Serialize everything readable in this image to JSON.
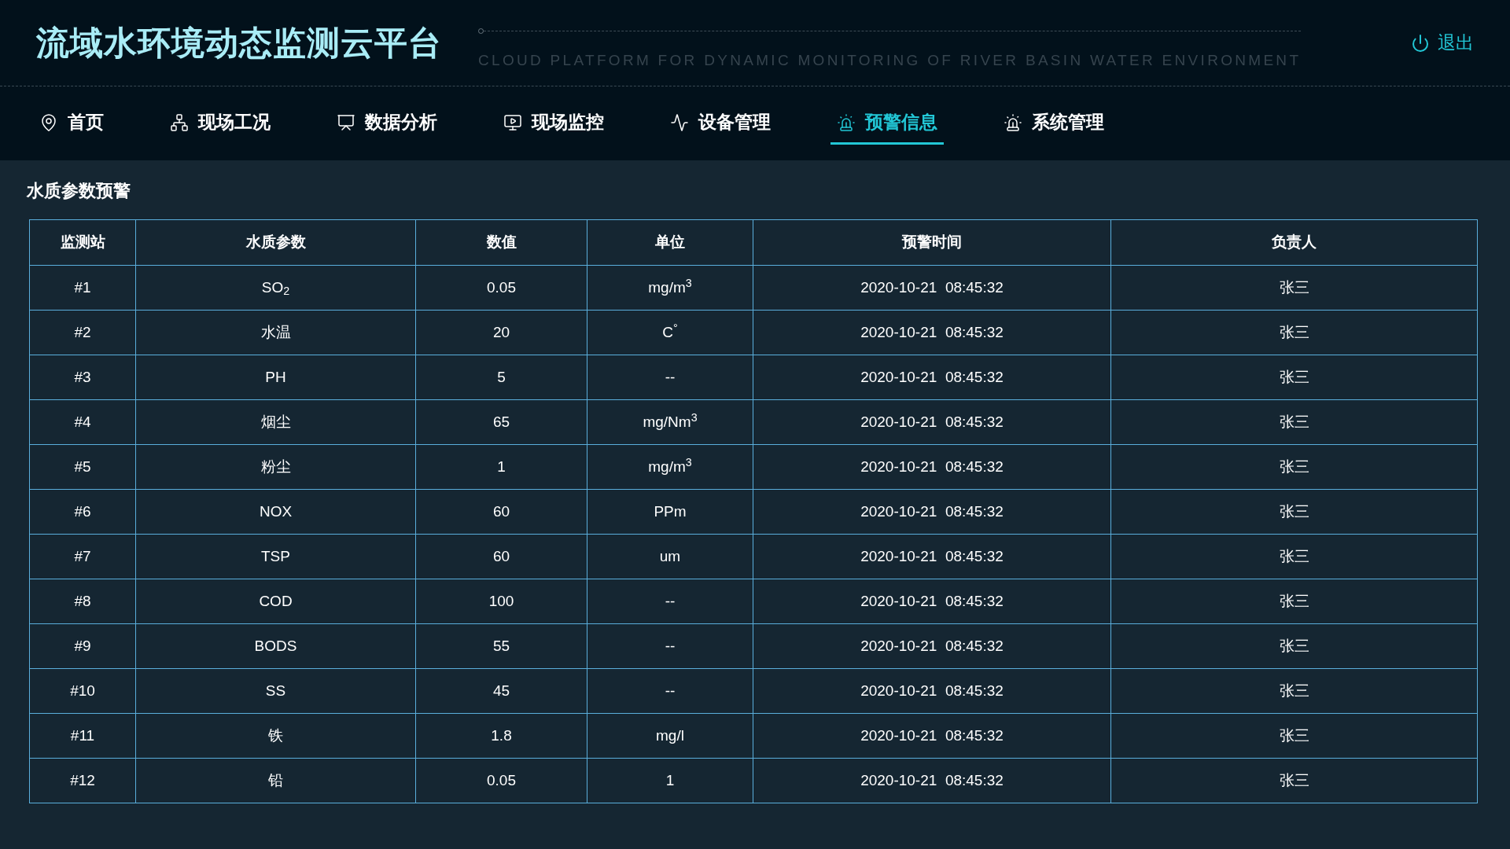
{
  "header": {
    "title": "流域水环境动态监测云平台",
    "subtitle": "CLOUD PLATFORM FOR DYNAMIC MONITORING OF RIVER BASIN WATER ENVIRONMENT",
    "logout": "退出"
  },
  "nav": [
    {
      "label": "首页",
      "selected": false
    },
    {
      "label": "现场工况",
      "selected": false
    },
    {
      "label": "数据分析",
      "selected": false
    },
    {
      "label": "现场监控",
      "selected": false
    },
    {
      "label": "设备管理",
      "selected": false
    },
    {
      "label": "预警信息",
      "selected": true
    },
    {
      "label": "系统管理",
      "selected": false
    }
  ],
  "section_title": "水质参数预警",
  "table": {
    "columns": [
      "监测站",
      "水质参数",
      "数值",
      "单位",
      "预警时间",
      "负责人"
    ],
    "rows": [
      [
        "#1",
        "SO$_{2}$",
        "0.05",
        "mg/m$^{3}$",
        "2020-10-21  08:45:32",
        "张三"
      ],
      [
        "#2",
        "水温",
        "20",
        "C$^{°}$",
        "2020-10-21  08:45:32",
        "张三"
      ],
      [
        "#3",
        "PH",
        "5",
        "--",
        "2020-10-21  08:45:32",
        "张三"
      ],
      [
        "#4",
        "烟尘",
        "65",
        "mg/Nm$^{3}$",
        "2020-10-21  08:45:32",
        "张三"
      ],
      [
        "#5",
        "粉尘",
        "1",
        "mg/m$^{3}$",
        "2020-10-21  08:45:32",
        "张三"
      ],
      [
        "#6",
        "NOX",
        "60",
        "PPm",
        "2020-10-21  08:45:32",
        "张三"
      ],
      [
        "#7",
        "TSP",
        "60",
        "um",
        "2020-10-21  08:45:32",
        "张三"
      ],
      [
        "#8",
        "COD",
        "100",
        "--",
        "2020-10-21  08:45:32",
        "张三"
      ],
      [
        "#9",
        "BODS",
        "55",
        "--",
        "2020-10-21  08:45:32",
        "张三"
      ],
      [
        "#10",
        "SS",
        "45",
        "--",
        "2020-10-21  08:45:32",
        "张三"
      ],
      [
        "#11",
        "铁",
        "1.8",
        "mg/l",
        "2020-10-21  08:45:32",
        "张三"
      ],
      [
        "#12",
        "铅",
        "0.05",
        "1",
        "2020-10-21  08:45:32",
        "张三"
      ]
    ]
  }
}
